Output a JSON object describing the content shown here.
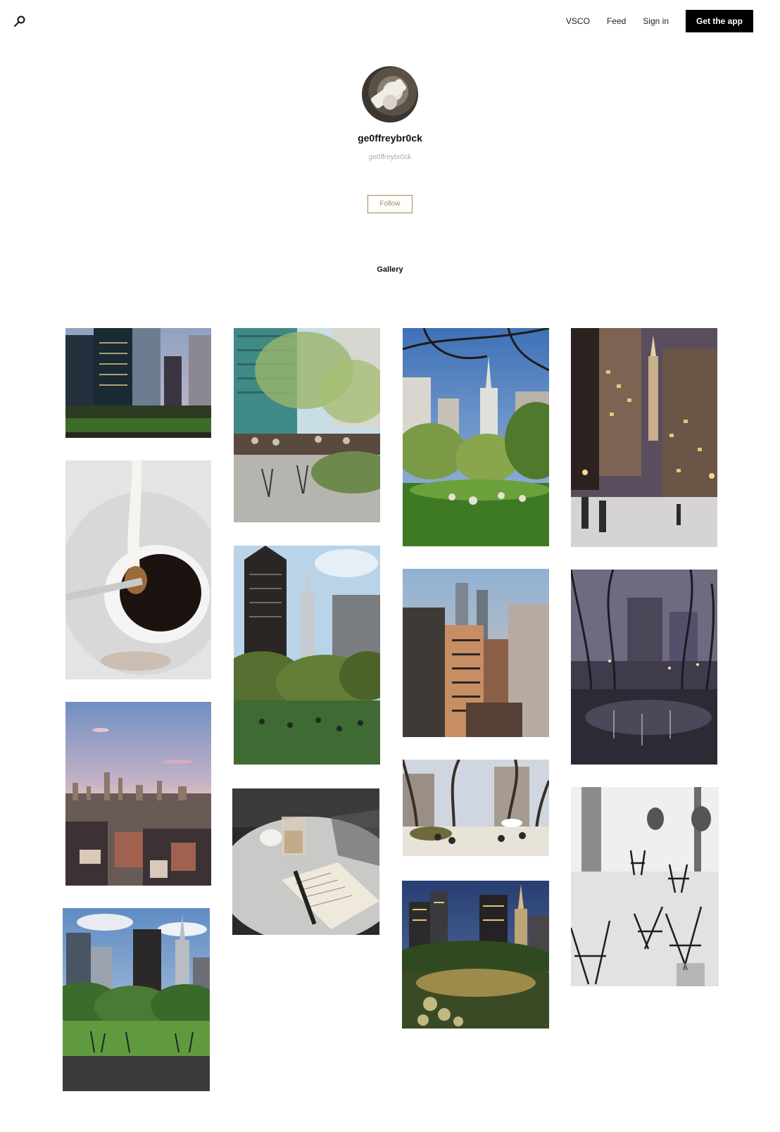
{
  "nav": {
    "search_icon": "search-icon",
    "links": [
      "VSCO",
      "Feed",
      "Sign in"
    ],
    "cta": "Get the app"
  },
  "profile": {
    "display_name": "ge0ffreybr0ck",
    "username": "ge0ffreybr0ck",
    "follow_label": "Follow",
    "accent_color": "#a58a4e"
  },
  "gallery": {
    "label": "Gallery",
    "photos": [
      "office-towers-dusk-park",
      "milk-pour-coffee-cup",
      "midtown-skyline-sunset",
      "bryant-park-trees-skyline",
      "park-cafe-tables-trees",
      "art-deco-tower-park-lawn",
      "cafe-table-coffee-book",
      "park-lawn-empire-state-spring",
      "sunlit-midtown-towers",
      "park-bare-trees-winter-sun",
      "park-night-lawn-skyline",
      "snowy-street-night",
      "rainy-park-night",
      "snowy-park-chairs-bw"
    ]
  }
}
